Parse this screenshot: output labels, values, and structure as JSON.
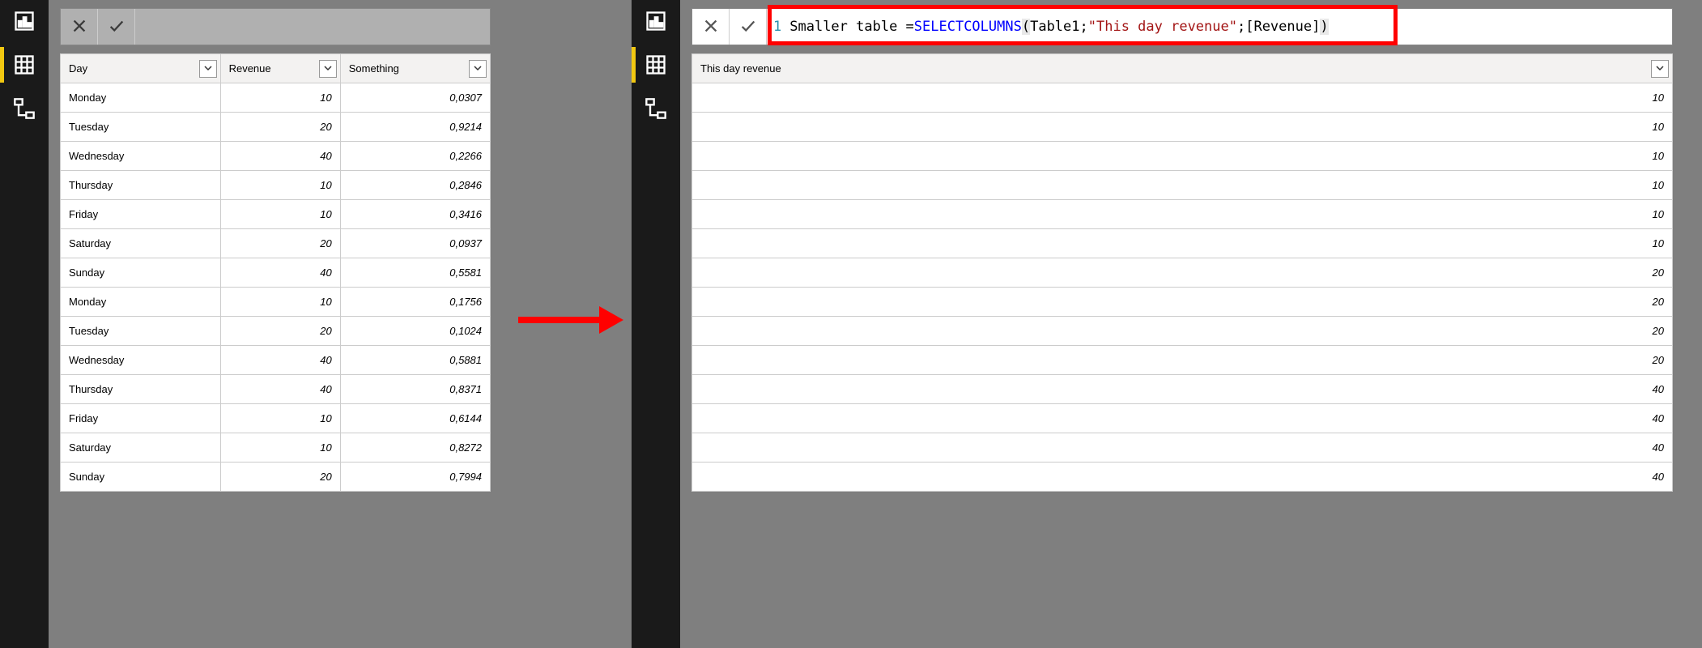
{
  "left": {
    "formula": {
      "empty": ""
    },
    "table": {
      "headers": {
        "day": "Day",
        "revenue": "Revenue",
        "something": "Something"
      },
      "rows": [
        {
          "day": "Monday",
          "revenue": "10",
          "something": "0,0307"
        },
        {
          "day": "Tuesday",
          "revenue": "20",
          "something": "0,9214"
        },
        {
          "day": "Wednesday",
          "revenue": "40",
          "something": "0,2266"
        },
        {
          "day": "Thursday",
          "revenue": "10",
          "something": "0,2846"
        },
        {
          "day": "Friday",
          "revenue": "10",
          "something": "0,3416"
        },
        {
          "day": "Saturday",
          "revenue": "20",
          "something": "0,0937"
        },
        {
          "day": "Sunday",
          "revenue": "40",
          "something": "0,5581"
        },
        {
          "day": "Monday",
          "revenue": "10",
          "something": "0,1756"
        },
        {
          "day": "Tuesday",
          "revenue": "20",
          "something": "0,1024"
        },
        {
          "day": "Wednesday",
          "revenue": "40",
          "something": "0,5881"
        },
        {
          "day": "Thursday",
          "revenue": "40",
          "something": "0,8371"
        },
        {
          "day": "Friday",
          "revenue": "10",
          "something": "0,6144"
        },
        {
          "day": "Saturday",
          "revenue": "10",
          "something": "0,8272"
        },
        {
          "day": "Sunday",
          "revenue": "20",
          "something": "0,7994"
        }
      ]
    }
  },
  "right": {
    "formula": {
      "line_no": "1",
      "prefix": "Smaller table = ",
      "fn": "SELECTCOLUMNS",
      "open": "(",
      "arg1": "Table1;",
      "str": "\"This day revenue\"",
      "arg_sep": ";[Revenue]",
      "close": ")"
    },
    "table": {
      "headers": {
        "col": "This day revenue"
      },
      "rows": [
        {
          "v": "10"
        },
        {
          "v": "10"
        },
        {
          "v": "10"
        },
        {
          "v": "10"
        },
        {
          "v": "10"
        },
        {
          "v": "10"
        },
        {
          "v": "20"
        },
        {
          "v": "20"
        },
        {
          "v": "20"
        },
        {
          "v": "20"
        },
        {
          "v": "40"
        },
        {
          "v": "40"
        },
        {
          "v": "40"
        },
        {
          "v": "40"
        }
      ]
    }
  }
}
